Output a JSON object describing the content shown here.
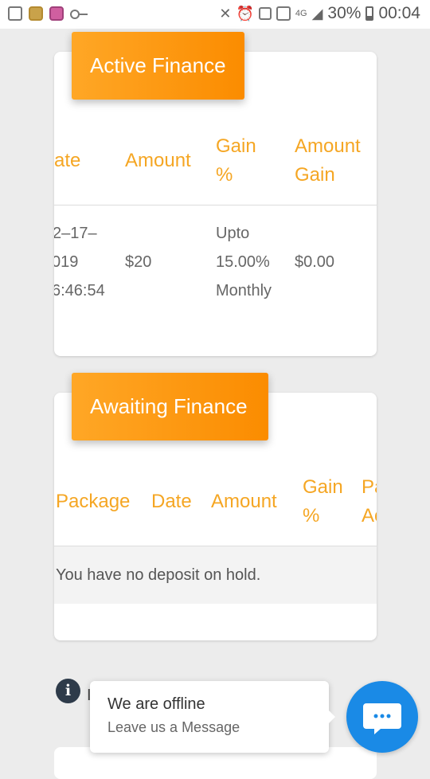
{
  "status_bar": {
    "battery_percent": "30%",
    "time": "00:04",
    "network": "4G"
  },
  "active_finance": {
    "title": "Active Finance",
    "headers": [
      "ate",
      "Amount",
      "Gain",
      "%",
      "Amount",
      "Gain"
    ],
    "row": {
      "date_lines": [
        "2–17–",
        "019",
        "6:46:54"
      ],
      "amount": "$20",
      "gain_lines": [
        "Upto",
        "15.00%",
        "Monthly"
      ],
      "amount_gain": "$0.00"
    }
  },
  "awaiting_finance": {
    "title": "Awaiting Finance",
    "headers": {
      "package": "Package",
      "date": "Date",
      "amount": "Amount",
      "gain_1": "Gain",
      "gain_2": "%",
      "cut_1": "Pa",
      "cut_2": "Ac"
    },
    "empty_message": "You have no deposit on hold."
  },
  "chat": {
    "status": "We are offline",
    "cta": "Leave us a Message"
  },
  "colors": {
    "accent": "#fb8c00",
    "header_text": "#f5a623",
    "chat_blue": "#1a8ae6"
  }
}
